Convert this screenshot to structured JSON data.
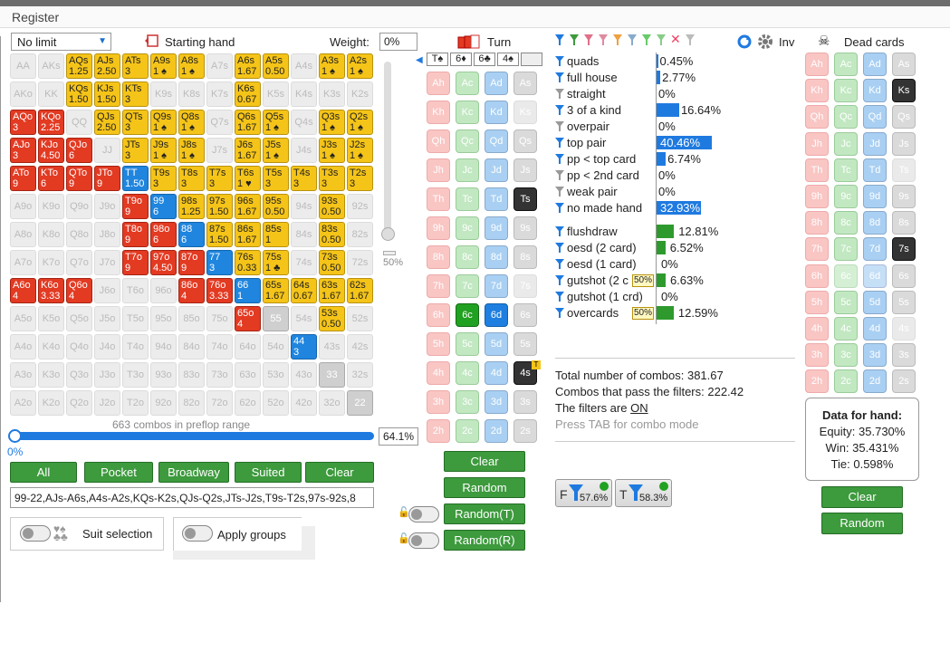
{
  "window": {
    "title": "Register"
  },
  "controls": {
    "game_type": "No limit",
    "starting_hand_label": "Starting hand",
    "weight_label": "Weight:",
    "weight_value": "0%",
    "slider_value": "50%",
    "range_pct": "64.1%",
    "slider_min": "0%",
    "combos_text": "663 combos in preflop range",
    "range_text": "99-22,AJs-A6s,A4s-A2s,KQs-K2s,QJs-Q2s,JTs-J2s,T9s-T2s,97s-92s,8"
  },
  "quick_buttons": [
    "All",
    "Pocket",
    "Broadway",
    "Suited",
    "Clear"
  ],
  "options": {
    "suit_selection": "Suit selection",
    "apply_groups": "Apply groups"
  },
  "matrix": [
    [
      [
        "AA",
        "",
        "e"
      ],
      [
        "AKs",
        "",
        "e"
      ],
      [
        "AQs",
        "1.25",
        "y"
      ],
      [
        "AJs",
        "2.50",
        "y"
      ],
      [
        "ATs",
        "3",
        "y"
      ],
      [
        "A9s",
        "1 ♠",
        "y"
      ],
      [
        "A8s",
        "1 ♠",
        "y"
      ],
      [
        "A7s",
        "",
        "e"
      ],
      [
        "A6s",
        "1.67",
        "y"
      ],
      [
        "A5s",
        "0.50",
        "y"
      ],
      [
        "A4s",
        "",
        "e"
      ],
      [
        "A3s",
        "1 ♠",
        "y"
      ],
      [
        "A2s",
        "1 ♠",
        "y"
      ]
    ],
    [
      [
        "AKo",
        "",
        "e"
      ],
      [
        "KK",
        "",
        "e"
      ],
      [
        "KQs",
        "1.50",
        "y"
      ],
      [
        "KJs",
        "1.50",
        "y"
      ],
      [
        "KTs",
        "3",
        "y"
      ],
      [
        "K9s",
        "",
        "e"
      ],
      [
        "K8s",
        "",
        "e"
      ],
      [
        "K7s",
        "",
        "e"
      ],
      [
        "K6s",
        "0.67",
        "y"
      ],
      [
        "K5s",
        "",
        "e"
      ],
      [
        "K4s",
        "",
        "e"
      ],
      [
        "K3s",
        "",
        "e"
      ],
      [
        "K2s",
        "",
        "e"
      ]
    ],
    [
      [
        "AQo",
        "3",
        "r"
      ],
      [
        "KQo",
        "2.25",
        "r"
      ],
      [
        "QQ",
        "",
        "e"
      ],
      [
        "QJs",
        "2.50",
        "y"
      ],
      [
        "QTs",
        "3",
        "y"
      ],
      [
        "Q9s",
        "1 ♠",
        "y"
      ],
      [
        "Q8s",
        "1 ♠",
        "y"
      ],
      [
        "Q7s",
        "",
        "e"
      ],
      [
        "Q6s",
        "1.67",
        "y"
      ],
      [
        "Q5s",
        "1 ♠",
        "y"
      ],
      [
        "Q4s",
        "",
        "e"
      ],
      [
        "Q3s",
        "1 ♠",
        "y"
      ],
      [
        "Q2s",
        "1 ♠",
        "y"
      ]
    ],
    [
      [
        "AJo",
        "3",
        "r"
      ],
      [
        "KJo",
        "4.50",
        "r"
      ],
      [
        "QJo",
        "6",
        "r"
      ],
      [
        "JJ",
        "",
        "e"
      ],
      [
        "JTs",
        "3",
        "y"
      ],
      [
        "J9s",
        "1 ♠",
        "y"
      ],
      [
        "J8s",
        "1 ♠",
        "y"
      ],
      [
        "J7s",
        "",
        "e"
      ],
      [
        "J6s",
        "1.67",
        "y"
      ],
      [
        "J5s",
        "1 ♠",
        "y"
      ],
      [
        "J4s",
        "",
        "e"
      ],
      [
        "J3s",
        "1 ♠",
        "y"
      ],
      [
        "J2s",
        "1 ♠",
        "y"
      ]
    ],
    [
      [
        "ATo",
        "9",
        "r"
      ],
      [
        "KTo",
        "6",
        "r"
      ],
      [
        "QTo",
        "9",
        "r"
      ],
      [
        "JTo",
        "9",
        "r"
      ],
      [
        "TT",
        "1.50",
        "b"
      ],
      [
        "T9s",
        "3",
        "y"
      ],
      [
        "T8s",
        "3",
        "y"
      ],
      [
        "T7s",
        "3",
        "y"
      ],
      [
        "T6s",
        "1 ♥",
        "y"
      ],
      [
        "T5s",
        "3",
        "y"
      ],
      [
        "T4s",
        "3",
        "y"
      ],
      [
        "T3s",
        "3",
        "y"
      ],
      [
        "T2s",
        "3",
        "y"
      ]
    ],
    [
      [
        "A9o",
        "",
        "e"
      ],
      [
        "K9o",
        "",
        "e"
      ],
      [
        "Q9o",
        "",
        "e"
      ],
      [
        "J9o",
        "",
        "e"
      ],
      [
        "T9o",
        "9",
        "r"
      ],
      [
        "99",
        "6",
        "b"
      ],
      [
        "98s",
        "1.25",
        "y"
      ],
      [
        "97s",
        "1.50",
        "y"
      ],
      [
        "96s",
        "1.67",
        "y"
      ],
      [
        "95s",
        "0.50",
        "y"
      ],
      [
        "94s",
        "",
        "e"
      ],
      [
        "93s",
        "0.50",
        "y"
      ],
      [
        "92s",
        "",
        "e"
      ]
    ],
    [
      [
        "A8o",
        "",
        "e"
      ],
      [
        "K8o",
        "",
        "e"
      ],
      [
        "Q8o",
        "",
        "e"
      ],
      [
        "J8o",
        "",
        "e"
      ],
      [
        "T8o",
        "9",
        "r"
      ],
      [
        "98o",
        "6",
        "r"
      ],
      [
        "88",
        "6",
        "b"
      ],
      [
        "87s",
        "1.50",
        "y"
      ],
      [
        "86s",
        "1.67",
        "y"
      ],
      [
        "85s",
        "1",
        "y"
      ],
      [
        "84s",
        "",
        "e"
      ],
      [
        "83s",
        "0.50",
        "y"
      ],
      [
        "82s",
        "",
        "e"
      ]
    ],
    [
      [
        "A7o",
        "",
        "e"
      ],
      [
        "K7o",
        "",
        "e"
      ],
      [
        "Q7o",
        "",
        "e"
      ],
      [
        "J7o",
        "",
        "e"
      ],
      [
        "T7o",
        "9",
        "r"
      ],
      [
        "97o",
        "4.50",
        "r"
      ],
      [
        "87o",
        "9",
        "r"
      ],
      [
        "77",
        "3",
        "b"
      ],
      [
        "76s",
        "0.33",
        "y"
      ],
      [
        "75s",
        "1 ♣",
        "y"
      ],
      [
        "74s",
        "",
        "e"
      ],
      [
        "73s",
        "0.50",
        "y"
      ],
      [
        "72s",
        "",
        "e"
      ]
    ],
    [
      [
        "A6o",
        "4",
        "r"
      ],
      [
        "K6o",
        "3.33",
        "r"
      ],
      [
        "Q6o",
        "4",
        "r"
      ],
      [
        "J6o",
        "",
        "e"
      ],
      [
        "T6o",
        "",
        "e"
      ],
      [
        "96o",
        "",
        "e"
      ],
      [
        "86o",
        "4",
        "r"
      ],
      [
        "76o",
        "3.33",
        "r"
      ],
      [
        "66",
        "1",
        "b"
      ],
      [
        "65s",
        "1.67",
        "y"
      ],
      [
        "64s",
        "0.67",
        "y"
      ],
      [
        "63s",
        "1.67",
        "y"
      ],
      [
        "62s",
        "1.67",
        "y"
      ]
    ],
    [
      [
        "A5o",
        "",
        "e"
      ],
      [
        "K5o",
        "",
        "e"
      ],
      [
        "Q5o",
        "",
        "e"
      ],
      [
        "J5o",
        "",
        "e"
      ],
      [
        "T5o",
        "",
        "e"
      ],
      [
        "95o",
        "",
        "e"
      ],
      [
        "85o",
        "",
        "e"
      ],
      [
        "75o",
        "",
        "e"
      ],
      [
        "65o",
        "4",
        "r"
      ],
      [
        "55",
        "",
        "g"
      ],
      [
        "54s",
        "",
        "e"
      ],
      [
        "53s",
        "0.50",
        "y"
      ],
      [
        "52s",
        "",
        "e"
      ]
    ],
    [
      [
        "A4o",
        "",
        "e"
      ],
      [
        "K4o",
        "",
        "e"
      ],
      [
        "Q4o",
        "",
        "e"
      ],
      [
        "J4o",
        "",
        "e"
      ],
      [
        "T4o",
        "",
        "e"
      ],
      [
        "94o",
        "",
        "e"
      ],
      [
        "84o",
        "",
        "e"
      ],
      [
        "74o",
        "",
        "e"
      ],
      [
        "64o",
        "",
        "e"
      ],
      [
        "54o",
        "",
        "e"
      ],
      [
        "44",
        "3",
        "b"
      ],
      [
        "43s",
        "",
        "e"
      ],
      [
        "42s",
        "",
        "e"
      ]
    ],
    [
      [
        "A3o",
        "",
        "e"
      ],
      [
        "K3o",
        "",
        "e"
      ],
      [
        "Q3o",
        "",
        "e"
      ],
      [
        "J3o",
        "",
        "e"
      ],
      [
        "T3o",
        "",
        "e"
      ],
      [
        "93o",
        "",
        "e"
      ],
      [
        "83o",
        "",
        "e"
      ],
      [
        "73o",
        "",
        "e"
      ],
      [
        "63o",
        "",
        "e"
      ],
      [
        "53o",
        "",
        "e"
      ],
      [
        "43o",
        "",
        "e"
      ],
      [
        "33",
        "",
        "g"
      ],
      [
        "32s",
        "",
        "e"
      ]
    ],
    [
      [
        "A2o",
        "",
        "e"
      ],
      [
        "K2o",
        "",
        "e"
      ],
      [
        "Q2o",
        "",
        "e"
      ],
      [
        "J2o",
        "",
        "e"
      ],
      [
        "T2o",
        "",
        "e"
      ],
      [
        "92o",
        "",
        "e"
      ],
      [
        "82o",
        "",
        "e"
      ],
      [
        "72o",
        "",
        "e"
      ],
      [
        "62o",
        "",
        "e"
      ],
      [
        "52o",
        "",
        "e"
      ],
      [
        "42o",
        "",
        "e"
      ],
      [
        "32o",
        "",
        "e"
      ],
      [
        "22",
        "",
        "g"
      ]
    ]
  ],
  "board": {
    "turn_label": "Turn",
    "cards": [
      "T♠",
      "6♦",
      "6♣",
      "4♠",
      ""
    ]
  },
  "turn_deck": [
    [
      "Ah",
      "Ac",
      "Ad",
      "As"
    ],
    [
      "Kh",
      "Kc",
      "Kd",
      "Ks"
    ],
    [
      "Qh",
      "Qc",
      "Qd",
      "Qs"
    ],
    [
      "Jh",
      "Jc",
      "Jd",
      "Js"
    ],
    [
      "Th",
      "Tc",
      "Td",
      "Ts"
    ],
    [
      "9h",
      "9c",
      "9d",
      "9s"
    ],
    [
      "8h",
      "8c",
      "8d",
      "8s"
    ],
    [
      "7h",
      "7c",
      "7d",
      "7s"
    ],
    [
      "6h",
      "6c",
      "6d",
      "6s"
    ],
    [
      "5h",
      "5c",
      "5d",
      "5s"
    ],
    [
      "4h",
      "4c",
      "4d",
      "4s"
    ],
    [
      "3h",
      "3c",
      "3d",
      "3s"
    ],
    [
      "2h",
      "2c",
      "2d",
      "2s"
    ]
  ],
  "turn_styles": [
    [
      "h",
      "c",
      "d",
      "s"
    ],
    [
      "h",
      "c",
      "d",
      "sf"
    ],
    [
      "h",
      "c",
      "d",
      "s"
    ],
    [
      "h",
      "c",
      "d",
      "s"
    ],
    [
      "h",
      "c",
      "d",
      "sk"
    ],
    [
      "h",
      "c",
      "d",
      "s"
    ],
    [
      "h",
      "c",
      "d",
      "s"
    ],
    [
      "h",
      "c",
      "d",
      "sf"
    ],
    [
      "h",
      "cg",
      "db",
      "s"
    ],
    [
      "h",
      "c",
      "d",
      "s"
    ],
    [
      "h",
      "c",
      "d",
      "sk"
    ],
    [
      "h",
      "c",
      "d",
      "s"
    ],
    [
      "h",
      "c",
      "d",
      "s"
    ]
  ],
  "turn_buttons": [
    "Clear",
    "Random",
    "Random(T)",
    "Random(R)"
  ],
  "filters_header": {
    "inv_label": "Inv"
  },
  "stats_made": [
    {
      "name": "quads",
      "pct": "0.45%",
      "v": 0.45,
      "c": "#1f7ae0"
    },
    {
      "name": "full house",
      "pct": "2.77%",
      "v": 2.77,
      "c": "#1f7ae0"
    },
    {
      "name": "straight",
      "pct": "0%",
      "v": 0,
      "c": "#1f7ae0"
    },
    {
      "name": "3 of a kind",
      "pct": "16.64%",
      "v": 16.64,
      "c": "#1f7ae0"
    },
    {
      "name": "overpair",
      "pct": "0%",
      "v": 0,
      "c": "#1f7ae0"
    },
    {
      "name": "top pair",
      "pct": "40.46%",
      "v": 40.46,
      "c": "#1f7ae0"
    },
    {
      "name": "pp < top card",
      "pct": "6.74%",
      "v": 6.74,
      "c": "#1f7ae0"
    },
    {
      "name": "pp < 2nd card",
      "pct": "0%",
      "v": 0,
      "c": "#1f7ae0"
    },
    {
      "name": "weak pair",
      "pct": "0%",
      "v": 0,
      "c": "#1f7ae0"
    },
    {
      "name": "no made hand",
      "pct": "32.93%",
      "v": 32.93,
      "c": "#1f7ae0"
    }
  ],
  "stats_draws": [
    {
      "name": "flushdraw",
      "pct": "12.81%",
      "v": 12.81,
      "badge": ""
    },
    {
      "name": "oesd (2 card)",
      "pct": "6.52%",
      "v": 6.52,
      "badge": ""
    },
    {
      "name": "oesd (1 card)",
      "pct": "0%",
      "v": 0,
      "badge": ""
    },
    {
      "name": "gutshot (2 c",
      "pct": "6.63%",
      "v": 6.63,
      "badge": "50%"
    },
    {
      "name": "gutshot (1 crd)",
      "pct": "0%",
      "v": 0,
      "badge": ""
    },
    {
      "name": "overcards",
      "pct": "12.59%",
      "v": 12.59,
      "badge": "50%"
    }
  ],
  "summary": {
    "total": "Total number of combos: 381.67",
    "pass": "Combos that pass the filters: 222.42",
    "filters_on_prefix": "The filters are ",
    "filters_on": "ON",
    "hint": "Press TAB for combo mode"
  },
  "filter_badges": [
    {
      "letter": "F",
      "pct": "57.6%"
    },
    {
      "letter": "T",
      "pct": "58.3%"
    }
  ],
  "dead": {
    "title": "Dead cards",
    "data_title": "Data for hand:",
    "equity": "Equity: 35.730%",
    "win": "Win: 35.431%",
    "tie": "Tie: 0.598%",
    "buttons": [
      "Clear",
      "Random"
    ]
  },
  "dead_deck": [
    [
      "Ah",
      "Ac",
      "Ad",
      "As"
    ],
    [
      "Kh",
      "Kc",
      "Kd",
      "Ks"
    ],
    [
      "Qh",
      "Qc",
      "Qd",
      "Qs"
    ],
    [
      "Jh",
      "Jc",
      "Jd",
      "Js"
    ],
    [
      "Th",
      "Tc",
      "Td",
      "Ts"
    ],
    [
      "9h",
      "9c",
      "9d",
      "9s"
    ],
    [
      "8h",
      "8c",
      "8d",
      "8s"
    ],
    [
      "7h",
      "7c",
      "7d",
      "7s"
    ],
    [
      "6h",
      "6c",
      "6d",
      "6s"
    ],
    [
      "5h",
      "5c",
      "5d",
      "5s"
    ],
    [
      "4h",
      "4c",
      "4d",
      "4s"
    ],
    [
      "3h",
      "3c",
      "3d",
      "3s"
    ],
    [
      "2h",
      "2c",
      "2d",
      "2s"
    ]
  ],
  "dead_styles": [
    [
      "h",
      "c",
      "d",
      "s"
    ],
    [
      "h",
      "c",
      "d",
      "sk"
    ],
    [
      "h",
      "c",
      "d",
      "s"
    ],
    [
      "h",
      "c",
      "d",
      "s"
    ],
    [
      "h",
      "c",
      "d",
      "sf"
    ],
    [
      "h",
      "c",
      "d",
      "s"
    ],
    [
      "h",
      "c",
      "d",
      "s"
    ],
    [
      "h",
      "c",
      "d",
      "sk"
    ],
    [
      "h",
      "cf",
      "df",
      "s"
    ],
    [
      "h",
      "c",
      "d",
      "s"
    ],
    [
      "h",
      "c",
      "d",
      "sf"
    ],
    [
      "h",
      "c",
      "d",
      "s"
    ],
    [
      "h",
      "c",
      "d",
      "s"
    ]
  ]
}
